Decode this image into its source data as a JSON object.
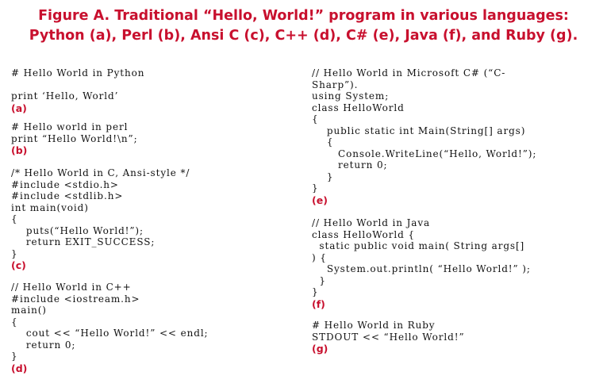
{
  "title": {
    "line1": "Figure A. Traditional “Hello, World!” program in various languages:",
    "line2": "Python (a), Perl (b), Ansi C (c), C++ (d), C# (e), Java (f), and Ruby (g)."
  },
  "examples": {
    "python": {
      "code": "# Hello World in Python\n\nprint ‘Hello, World’",
      "label": "(a)"
    },
    "perl": {
      "code": "# Hello world in perl\nprint “Hello World!\\n”;",
      "label": "(b)"
    },
    "ansi_c": {
      "code": "/* Hello World in C, Ansi-style */\n#include <stdio.h>\n#include <stdlib.h>\nint main(void)\n{\n    puts(“Hello World!”);\n    return EXIT_SUCCESS;\n}",
      "label": "(c)"
    },
    "cpp": {
      "code": "// Hello World in C++\n#include <iostream.h>\nmain()\n{\n    cout << “Hello World!” << endl;\n    return 0;\n}",
      "label": "(d)"
    },
    "csharp": {
      "code": "// Hello World in Microsoft C# (“C-\nSharp”).\nusing System;\nclass HelloWorld\n{\n    public static int Main(String[] args)\n    {\n       Console.WriteLine(“Hello, World!”);\n       return 0;\n    }\n}",
      "label": "(e)"
    },
    "java": {
      "code": "// Hello World in Java\nclass HelloWorld {\n  static public void main( String args[]\n) {\n    System.out.println( “Hello World!” );\n  }\n}",
      "label": "(f)"
    },
    "ruby": {
      "code": "# Hello World in Ruby\nSTDOUT << “Hello World!”",
      "label": "(g)"
    }
  }
}
